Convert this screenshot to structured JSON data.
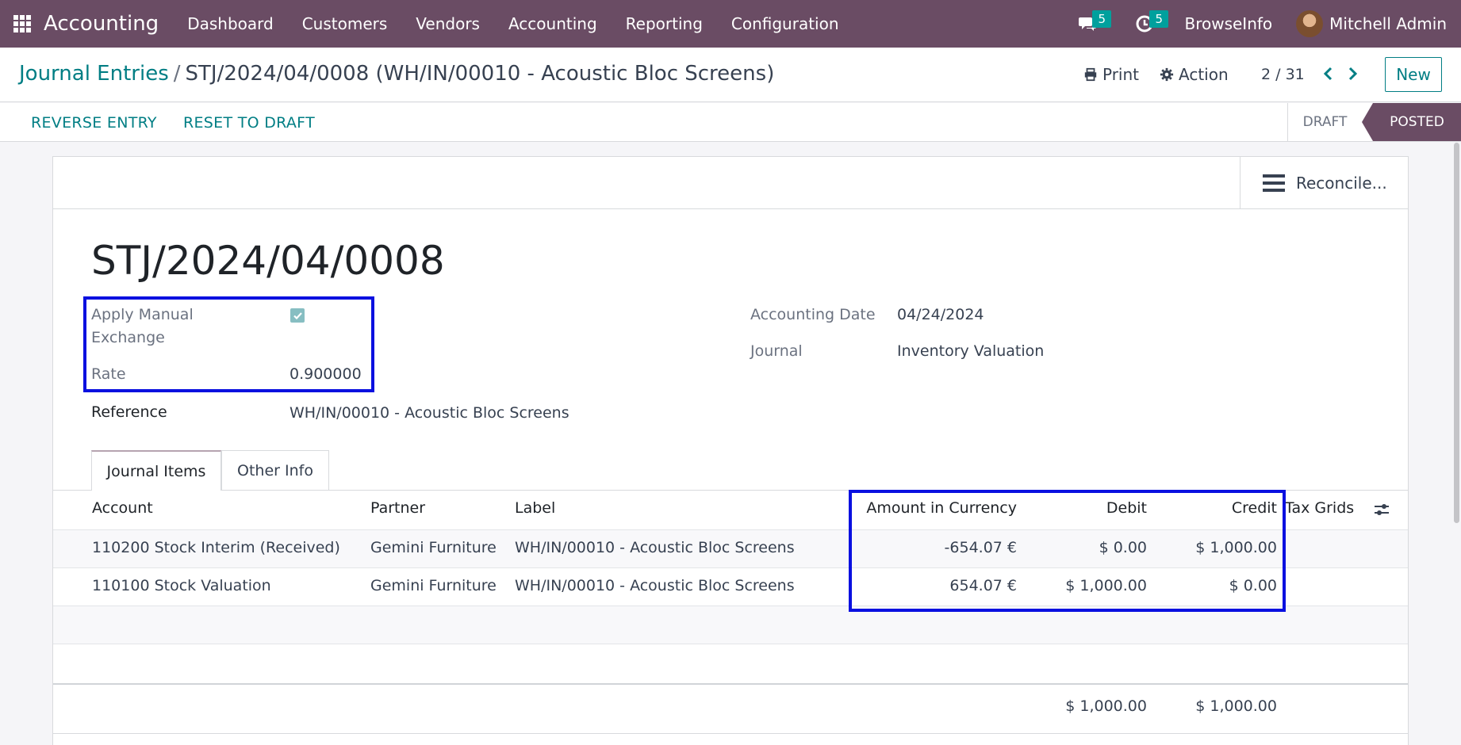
{
  "navbar": {
    "app_name": "Accounting",
    "menu": [
      "Dashboard",
      "Customers",
      "Vendors",
      "Accounting",
      "Reporting",
      "Configuration"
    ],
    "messages_count": "5",
    "activities_count": "5",
    "company": "BrowseInfo",
    "user": "Mitchell Admin"
  },
  "control": {
    "breadcrumb_parent": "Journal Entries",
    "breadcrumb_separator": "/",
    "breadcrumb_current": "STJ/2024/04/0008 (WH/IN/00010 - Acoustic Bloc Screens)",
    "print_label": "Print",
    "action_label": "Action",
    "pager": "2 / 31",
    "new_label": "New"
  },
  "statusbar": {
    "reverse_label": "REVERSE ENTRY",
    "reset_label": "RESET TO DRAFT",
    "stages": [
      "DRAFT",
      "POSTED"
    ],
    "current_stage": "POSTED"
  },
  "sheet": {
    "reconcile_label": "Reconcile...",
    "title": "STJ/2024/04/0008",
    "apply_manual_label_1": "Apply Manual",
    "apply_manual_label_2": "Exchange",
    "apply_manual_checked": true,
    "rate_label": "Rate",
    "rate_value": "0.900000",
    "reference_label": "Reference",
    "reference_value": "WH/IN/00010 - Acoustic Bloc Screens",
    "accounting_date_label": "Accounting Date",
    "accounting_date_value": "04/24/2024",
    "journal_label": "Journal",
    "journal_value": "Inventory Valuation"
  },
  "tabs": [
    "Journal Items",
    "Other Info"
  ],
  "table": {
    "columns": [
      "Account",
      "Partner",
      "Label",
      "Amount in Currency",
      "Debit",
      "Credit",
      "Tax Grids"
    ],
    "rows": [
      {
        "account": "110200 Stock Interim (Received)",
        "partner": "Gemini Furniture",
        "label": "WH/IN/00010 - Acoustic Bloc Screens",
        "amount_currency": "-654.07 €",
        "debit": "$ 0.00",
        "credit": "$ 1,000.00"
      },
      {
        "account": "110100 Stock Valuation",
        "partner": "Gemini Furniture",
        "label": "WH/IN/00010 - Acoustic Bloc Screens",
        "amount_currency": "654.07 €",
        "debit": "$ 1,000.00",
        "credit": "$ 0.00"
      }
    ],
    "total_debit": "$ 1,000.00",
    "total_credit": "$ 1,000.00"
  },
  "colors": {
    "navbar": "#6a4c64",
    "link": "#017e84",
    "badge": "#00a09d",
    "highlight": "#0a10e0"
  }
}
